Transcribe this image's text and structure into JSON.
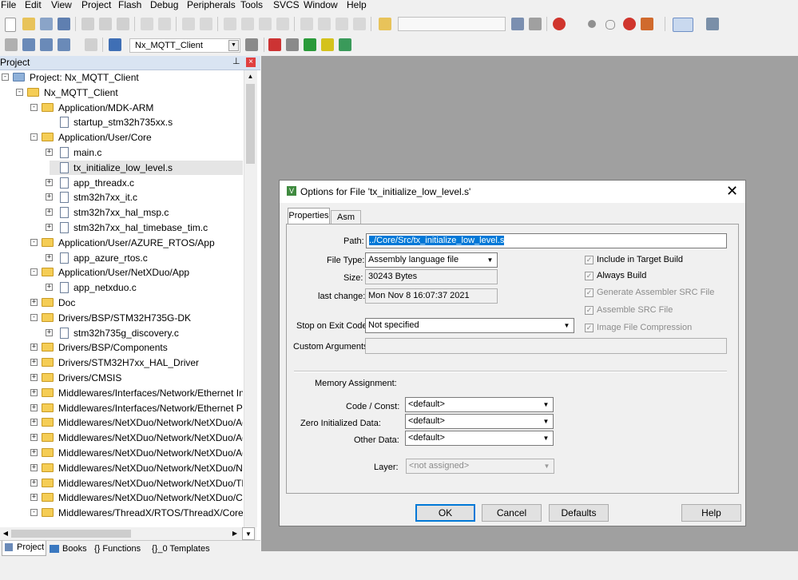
{
  "menubar": [
    "File",
    "Edit",
    "View",
    "Project",
    "Flash",
    "Debug",
    "Peripherals",
    "Tools",
    "SVCS",
    "Window",
    "Help"
  ],
  "toolbar2": {
    "target_select": "Nx_MQTT_Client"
  },
  "project_panel": {
    "title": "Project",
    "pin_icon": "pin-icon",
    "close_icon": "close-icon",
    "tree": [
      {
        "label": "Project: Nx_MQTT_Client",
        "type": "project",
        "expander": "−"
      },
      {
        "label": "Nx_MQTT_Client",
        "type": "target",
        "expander": "−"
      },
      {
        "label": "Application/MDK-ARM",
        "type": "folder",
        "expander": "−"
      },
      {
        "label": "startup_stm32h735xx.s",
        "type": "file",
        "expander": ""
      },
      {
        "label": "Application/User/Core",
        "type": "folder",
        "expander": "−"
      },
      {
        "label": "main.c",
        "type": "file",
        "expander": "+"
      },
      {
        "label": "tx_initialize_low_level.s",
        "type": "file",
        "expander": "",
        "selected": true
      },
      {
        "label": "app_threadx.c",
        "type": "file",
        "expander": "+"
      },
      {
        "label": "stm32h7xx_it.c",
        "type": "file",
        "expander": "+"
      },
      {
        "label": "stm32h7xx_hal_msp.c",
        "type": "file",
        "expander": "+"
      },
      {
        "label": "stm32h7xx_hal_timebase_tim.c",
        "type": "file",
        "expander": "+"
      },
      {
        "label": "Application/User/AZURE_RTOS/App",
        "type": "folder",
        "expander": "−"
      },
      {
        "label": "app_azure_rtos.c",
        "type": "file",
        "expander": "+"
      },
      {
        "label": "Application/User/NetXDuo/App",
        "type": "folder",
        "expander": "−"
      },
      {
        "label": "app_netxduo.c",
        "type": "file",
        "expander": "+"
      },
      {
        "label": "Doc",
        "type": "folder",
        "expander": "+"
      },
      {
        "label": "Drivers/BSP/STM32H735G-DK",
        "type": "folder",
        "expander": "−"
      },
      {
        "label": "stm32h735g_discovery.c",
        "type": "file",
        "expander": "+"
      },
      {
        "label": "Drivers/BSP/Components",
        "type": "folder",
        "expander": "+"
      },
      {
        "label": "Drivers/STM32H7xx_HAL_Driver",
        "type": "folder",
        "expander": "+"
      },
      {
        "label": "Drivers/CMSIS",
        "type": "folder",
        "expander": "+"
      },
      {
        "label": "Middlewares/Interfaces/Network/Ethernet Inter",
        "type": "folder",
        "expander": "+"
      },
      {
        "label": "Middlewares/Interfaces/Network/Ethernet Phy",
        "type": "folder",
        "expander": "+"
      },
      {
        "label": "Middlewares/NetXDuo/Network/NetXDuo/Adc",
        "type": "folder",
        "expander": "+"
      },
      {
        "label": "Middlewares/NetXDuo/Network/NetXDuo/Adc",
        "type": "folder",
        "expander": "+"
      },
      {
        "label": "Middlewares/NetXDuo/Network/NetXDuo/Adc",
        "type": "folder",
        "expander": "+"
      },
      {
        "label": "Middlewares/NetXDuo/Network/NetXDuo/NX",
        "type": "folder",
        "expander": "+"
      },
      {
        "label": "Middlewares/NetXDuo/Network/NetXDuo/TLS",
        "type": "folder",
        "expander": "+"
      },
      {
        "label": "Middlewares/NetXDuo/Network/NetXDuo/Cry|",
        "type": "folder",
        "expander": "+"
      },
      {
        "label": "Middlewares/ThreadX/RTOS/ThreadX/Core",
        "type": "folder",
        "expander": "−"
      }
    ],
    "tabs": [
      "Project",
      "Books",
      "{} Functions",
      "{}_0 Templates"
    ]
  },
  "dialog": {
    "title": "Options for File 'tx_initialize_low_level.s'",
    "tabs": [
      "Properties",
      "Asm"
    ],
    "path_label": "Path:",
    "path_value": "../Core/Src/tx_initialize_low_level.s",
    "file_type_label": "File Type:",
    "file_type_value": "Assembly language file",
    "size_label": "Size:",
    "size_value": "30243 Bytes",
    "last_change_label": "last change:",
    "last_change_value": "Mon Nov  8 16:07:37 2021",
    "stop_label": "Stop on Exit Code:",
    "stop_value": "Not specified",
    "custom_args_label": "Custom Arguments:",
    "checkboxes": [
      {
        "label": "Include in Target Build",
        "checked": true,
        "enabled": true
      },
      {
        "label": "Always Build",
        "checked": true,
        "enabled": true
      },
      {
        "label": "Generate Assembler SRC File",
        "checked": true,
        "enabled": false
      },
      {
        "label": "Assemble SRC File",
        "checked": true,
        "enabled": false
      },
      {
        "label": "Image File Compression",
        "checked": true,
        "enabled": false
      }
    ],
    "memory_title": "Memory Assignment:",
    "code_const_label": "Code / Const:",
    "code_const_value": "<default>",
    "zero_init_label": "Zero Initialized Data:",
    "zero_init_value": "<default>",
    "other_data_label": "Other Data:",
    "other_data_value": "<default>",
    "layer_label": "Layer:",
    "layer_value": "<not assigned>",
    "buttons": {
      "ok": "OK",
      "cancel": "Cancel",
      "defaults": "Defaults",
      "help": "Help"
    }
  }
}
